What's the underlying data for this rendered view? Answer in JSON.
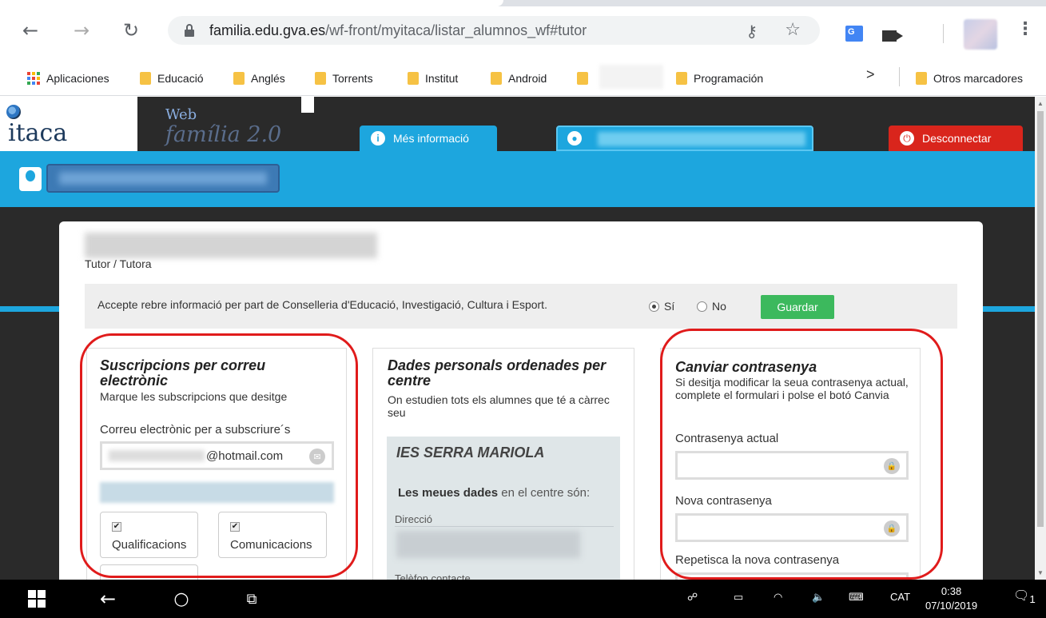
{
  "browser": {
    "url_domain": "familia.edu.gva.es",
    "url_path": "/wf-front/myitaca/listar_alumnos_wf#tutor",
    "bookmarks": [
      "Aplicaciones",
      "Educació",
      "Anglés",
      "Torrents",
      "Institut",
      "Android",
      "Programación",
      "Otros marcadores"
    ]
  },
  "header": {
    "logo": "itaca",
    "web_label": "Web",
    "familia_label": "família 2.0",
    "info_button": "Més informació",
    "disconnect_button": "Desconnectar"
  },
  "card": {
    "role": "Tutor / Tutora",
    "accept_text": "Accepte rebre informació per part de Conselleria d'Educació, Investigació, Cultura i Esport.",
    "radio_yes": "Sí",
    "radio_no": "No",
    "save_button": "Guardar",
    "subscriptions": {
      "title": "Suscripcions per correu electrònic",
      "subtitle": "Marque les subscripcions que desitge",
      "email_label": "Correu electrònic per a subscriure´s",
      "email_value": "@hotmail.com",
      "checkbox_1": "Qualificacions",
      "checkbox_2": "Comunicacions"
    },
    "personal": {
      "title": "Dades personals ordenades per centre",
      "subtitle": "On estudien tots els alumnes que té a càrrec seu",
      "school": "IES SERRA MARIOLA",
      "my_data_bold": "Les meues dades",
      "my_data_rest": " en el centre són:",
      "address_label": "Direcció",
      "phone_label": "Telèfon contacte"
    },
    "password": {
      "title": "Canviar contrasenya",
      "subtitle": "Si desitja modificar la seua contrasenya actual, complete el formulari i polse el botó Canvia",
      "current_label": "Contrasenya actual",
      "new_label": "Nova contrasenya",
      "repeat_label": "Repetisca la nova contrasenya"
    }
  },
  "taskbar": {
    "language": "CAT",
    "time": "0:38",
    "date": "07/10/2019",
    "notifications": "1"
  },
  "colors": {
    "accent_blue": "#1da6de",
    "disconnect_red": "#d9251c",
    "save_green": "#3cb95d",
    "highlight_red": "#e01b1b"
  }
}
